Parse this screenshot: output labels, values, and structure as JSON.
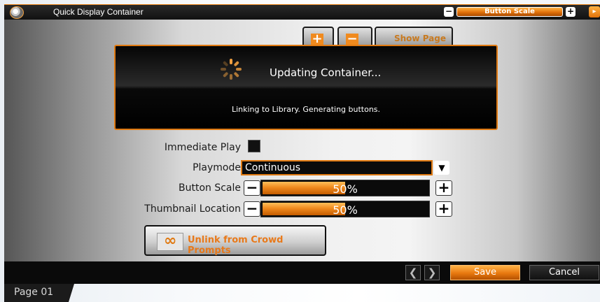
{
  "window": {
    "title": "Quick Display Container"
  },
  "header_scale": {
    "label": "Button Scale",
    "minus": "−",
    "plus": "+"
  },
  "toolbar": {
    "show_page_label": "Show Page",
    "add_glyph": "+",
    "remove_glyph": "−"
  },
  "modal": {
    "title": "Updating Container...",
    "message": "Linking to Library. Generating buttons."
  },
  "form": {
    "immediate_play": {
      "label": "Immediate Play",
      "checked": false
    },
    "playmode": {
      "label": "Playmode",
      "value": "Continuous",
      "arrow": "▼"
    },
    "button_scale": {
      "label": "Button Scale",
      "value": "50%",
      "fraction": 0.5,
      "minus": "−",
      "plus": "+"
    },
    "thumbnail_location": {
      "label": "Thumbnail Location",
      "value": "50%",
      "fraction": 0.5,
      "minus": "−",
      "plus": "+"
    },
    "unlink_button": {
      "label": "Unlink from Crowd Prompts"
    }
  },
  "footer": {
    "prev": "❮",
    "next": "❯",
    "save_label": "Save",
    "cancel_label": "Cancel",
    "page_tab": "Page 01"
  },
  "colors": {
    "accent": "#f08a1e",
    "panel_dark": "#0a0a0a"
  },
  "icons": [
    "app-icon",
    "add-page-icon",
    "remove-page-icon",
    "spinner-icon",
    "link-icon"
  ]
}
